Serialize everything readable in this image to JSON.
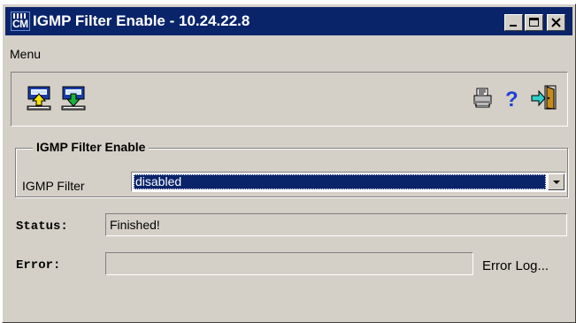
{
  "window": {
    "title": "IGMP Filter Enable - 10.24.22.8",
    "app_icon_text": "CM"
  },
  "menu": {
    "label": "Menu"
  },
  "toolbar": {
    "icons": [
      "upload-icon",
      "download-icon",
      "print-icon",
      "help-icon",
      "exit-icon"
    ]
  },
  "group": {
    "title": "IGMP Filter Enable",
    "filter_label": "IGMP Filter",
    "filter_value": "disabled"
  },
  "status": {
    "label": "Status:",
    "value": "Finished!"
  },
  "error": {
    "label": "Error:",
    "value": "",
    "log_link": "Error Log..."
  },
  "colors": {
    "title_bar": "#0a246a",
    "window_bg": "#d4d0c8",
    "selection": "#0a246a"
  }
}
